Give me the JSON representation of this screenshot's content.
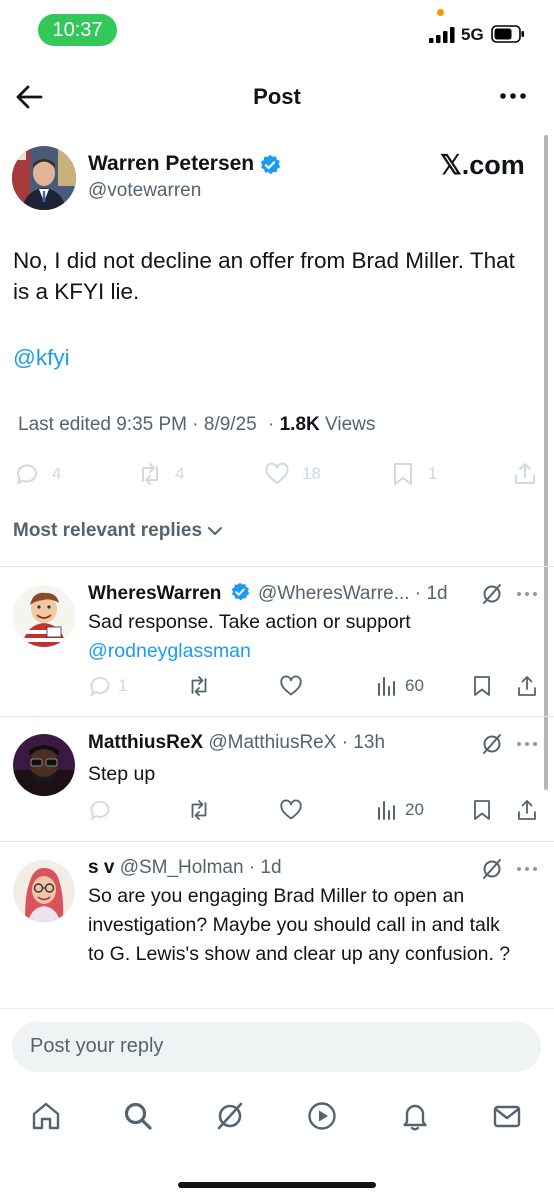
{
  "status_bar": {
    "time": "10:37",
    "network": "5G"
  },
  "header": {
    "title": "Post"
  },
  "post": {
    "author_name": "Warren Petersen",
    "author_handle": "@votewarren",
    "source_label": "𝕏.com",
    "text": "No, I did not decline an offer from Brad Miller. That is a KFYI lie.",
    "mention": "@kfyi",
    "meta": {
      "edited": "Last edited 9:35 PM · 8/9/25",
      "separator": "·",
      "views_count": "1.8K",
      "views_label": "Views"
    },
    "actions": {
      "replies": "4",
      "reposts": "4",
      "likes": "18",
      "bookmarks": "1"
    }
  },
  "replies_filter": {
    "label": "Most relevant replies"
  },
  "replies": [
    {
      "name": "WheresWarren",
      "handle": "@WheresWarre...",
      "time": "· 1d",
      "text": "Sad response. Take action or support",
      "link": "@rodneyglassman",
      "replies_count": "1",
      "views": "60",
      "verified": true
    },
    {
      "name": "MatthiusReX",
      "handle": "@MatthiusReX",
      "time": "· 13h",
      "text": "Step up",
      "views": "20",
      "verified": false
    },
    {
      "name": "s v",
      "handle": "@SM_Holman",
      "time": "· 1d",
      "text": "So are you engaging Brad Miller to open an investigation?  Maybe you should call in and talk to G. Lewis's show and clear up any confusion. ?",
      "verified": false
    }
  ],
  "composer": {
    "placeholder": "Post your reply"
  },
  "tabbar": {
    "items": [
      "home-icon",
      "search-icon",
      "grok-icon",
      "video-icon",
      "notifications-icon",
      "messages-icon"
    ]
  },
  "colors": {
    "accent": "#1d9bf0",
    "status_pill": "#34c759",
    "text_secondary": "#536471"
  }
}
